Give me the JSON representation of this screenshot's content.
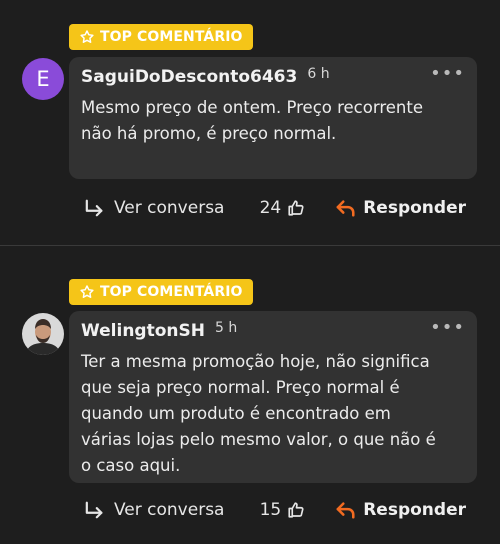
{
  "comments": [
    {
      "badge": "TOP COMENTÁRIO",
      "avatar_letter": "E",
      "author": "SaguiDoDesconto6463",
      "time": "6 h",
      "text": "Mesmo preço de ontem. Preço recorrente\nnão há promo, é preço normal.",
      "conversation_label": "Ver conversa",
      "likes": "24",
      "reply_label": "Responder"
    },
    {
      "badge": "TOP COMENTÁRIO",
      "author": "WelingtonSH",
      "time": "5 h",
      "text": "Ter a mesma promoção hoje, não significa\nque seja preço normal. Preço normal é\nquando um produto é encontrado em\nvárias lojas pelo mesmo valor, o que não é\no caso aqui.",
      "conversation_label": "Ver conversa",
      "likes": "15",
      "reply_label": "Responder"
    }
  ],
  "colors": {
    "background": "#1e1e1e",
    "badge": "#f5c518",
    "bubble": "#323232",
    "avatar_letter_bg": "#8a4bd9",
    "reply_arrow": "#f26b21"
  },
  "icons": [
    "star-icon",
    "more-options-icon",
    "conversation-arrow-icon",
    "thumbs-up-icon",
    "reply-arrow-icon"
  ]
}
